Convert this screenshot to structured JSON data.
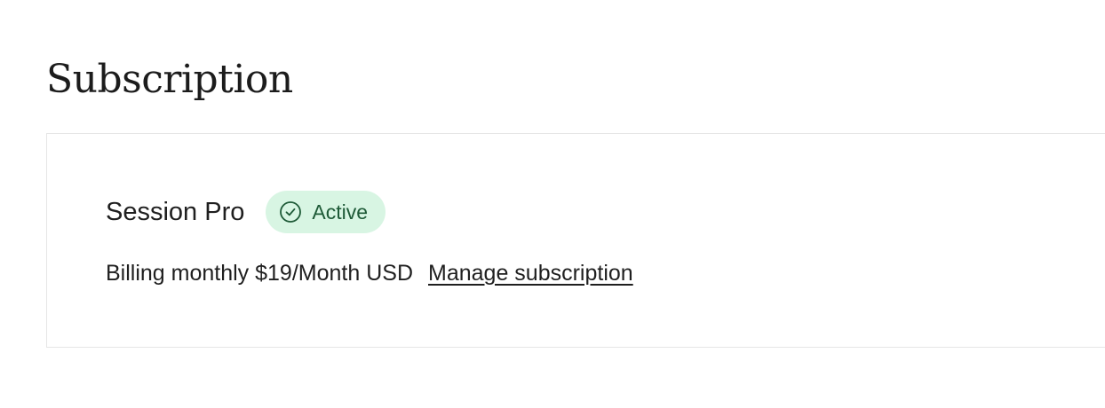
{
  "page": {
    "title": "Subscription"
  },
  "subscription": {
    "plan_name": "Session Pro",
    "status": {
      "label": "Active",
      "icon": "check-circle-icon"
    },
    "billing_text": "Billing monthly $19/Month USD",
    "manage_label": "Manage subscription"
  },
  "colors": {
    "badge_background": "#d8f5e3",
    "badge_text": "#1e5a37",
    "card_border": "#e6e6e6",
    "text": "#1f1f1f"
  }
}
